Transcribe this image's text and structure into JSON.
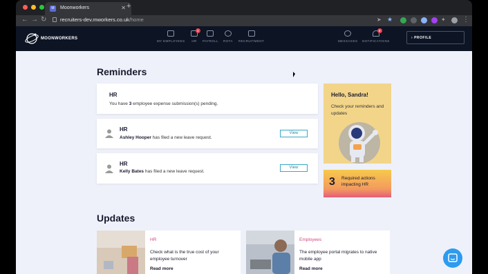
{
  "browser": {
    "tab_title": "Moonworkers",
    "new_tab_icon": "plus-icon",
    "url_host": "recruiters-dev.mworkers.co.uk",
    "url_path": "/home"
  },
  "app": {
    "logo_text": "MOONWORKERS",
    "nav": [
      {
        "label": "MY EMPLOYEES",
        "icon": "employees-icon"
      },
      {
        "label": "HR",
        "icon": "hr-icon",
        "badge": "2"
      },
      {
        "label": "PAYROLL",
        "icon": "payroll-icon"
      },
      {
        "label": "ROTA",
        "icon": "rota-icon"
      },
      {
        "label": "RECRUITMENT",
        "icon": "recruitment-icon"
      }
    ],
    "right_nav": [
      {
        "label": "MESSAGES",
        "icon": "messages-icon"
      },
      {
        "label": "NOTIFICATIONS",
        "icon": "bell-icon",
        "badge": "8"
      }
    ],
    "profile_label": "PROFILE",
    "profile_prefix": "›"
  },
  "reminders": {
    "heading": "Reminders",
    "items": [
      {
        "title": "HR",
        "text_pre": "You have ",
        "count": "3",
        "text_post": " employee expense submission(s) pending."
      },
      {
        "title": "HR",
        "name": "Ashley Hooper",
        "text": " has filed a new leave request.",
        "button": "View"
      },
      {
        "title": "HR",
        "name": "Kelly Bates",
        "text": " has filed a new leave request.",
        "button": "View"
      }
    ]
  },
  "hello": {
    "title": "Hello, Sandra!",
    "subtitle": "Check your reminders and updates"
  },
  "required": {
    "count": "3",
    "text": "Required actions impacting HR"
  },
  "updates": {
    "heading": "Updates",
    "items": [
      {
        "category": "HR",
        "category_color": "#d6457a",
        "text": "Check what is the true cost of your employee turnover",
        "link": "Read more"
      },
      {
        "category": "Employees",
        "category_color": "#d6457a",
        "text": "The employee portal migrates to native mobile app",
        "link": "Read more"
      }
    ]
  },
  "colors": {
    "accent": "#3aa7c4",
    "header_bg": "#0d1424",
    "badge": "#e8424f"
  }
}
